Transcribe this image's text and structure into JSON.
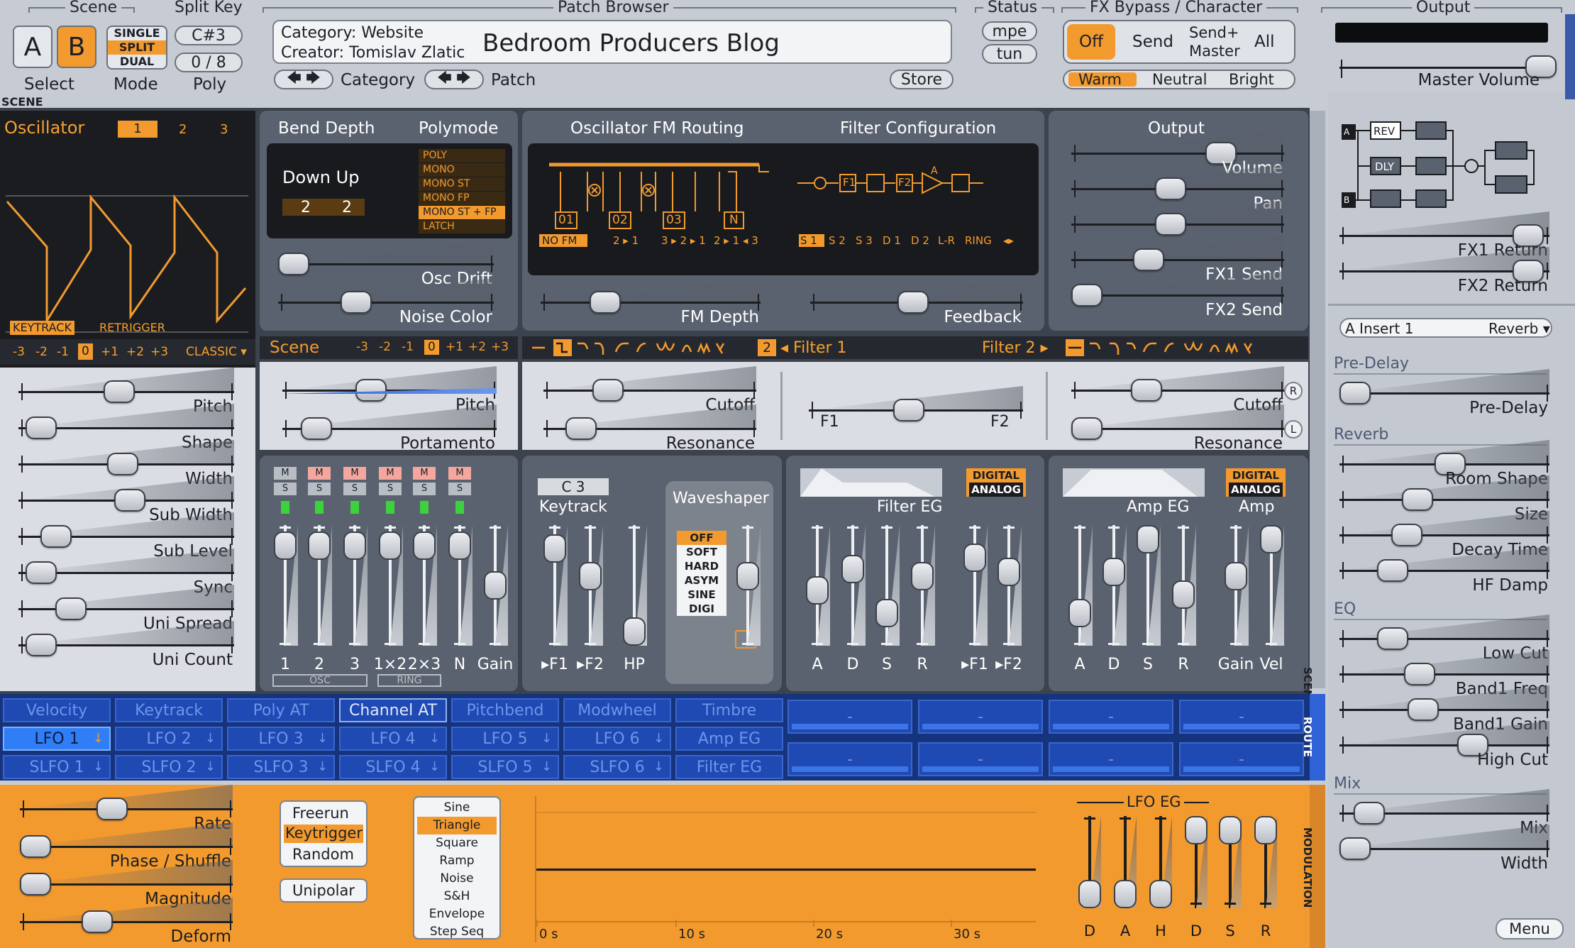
{
  "top": {
    "scene": {
      "title": "Scene",
      "btn_a": "A",
      "btn_b": "B",
      "select_label": "Select",
      "mode_label": "Mode",
      "modes": [
        "SINGLE",
        "SPLIT",
        "DUAL"
      ]
    },
    "split_key": {
      "title": "Split Key",
      "key": "C#3",
      "poly_value": "0 / 8",
      "poly_label": "Poly"
    },
    "patch_browser": {
      "title": "Patch Browser",
      "category_line": "Category: Website",
      "creator_line": "Creator: Tomislav Zlatic",
      "patch_name": "Bedroom Producers Blog",
      "category_label": "Category",
      "patch_label": "Patch",
      "store_label": "Store",
      "prev_glyph": "🡄",
      "next_glyph": "🡆"
    },
    "status": {
      "title": "Status",
      "mpe": "mpe",
      "tun": "tun"
    },
    "fx": {
      "title": "FX Bypass / Character",
      "off": "Off",
      "send": "Send",
      "send_master_1": "Send+",
      "send_master_2": "Master",
      "all": "All",
      "warm": "Warm",
      "neutral": "Neutral",
      "bright": "Bright"
    },
    "output": {
      "title": "Output",
      "master_volume": "Master Volume"
    }
  },
  "scene_tag": "SCENE",
  "osc": {
    "title": "Oscillator",
    "tabs": [
      "1",
      "2",
      "3"
    ],
    "keytrack": "KEYTRACK",
    "retrigger": "RETRIGGER",
    "octaves": [
      "-3",
      "-2",
      "-1",
      "0",
      "+1",
      "+2",
      "+3"
    ],
    "classic": "CLASSIC ▾",
    "sliders": [
      "Pitch",
      "Shape",
      "Width",
      "Sub Width",
      "Sub Level",
      "Sync",
      "Uni Spread",
      "Uni Count"
    ]
  },
  "bend": {
    "title": "Bend Depth",
    "polymode_title": "Polymode",
    "down_up": "Down Up",
    "down": "2",
    "up": "2",
    "polymodes": [
      "POLY",
      "MONO",
      "MONO ST",
      "MONO FP",
      "MONO ST + FP",
      "LATCH"
    ],
    "osc_drift": "Osc Drift",
    "noise_color": "Noise Color"
  },
  "scene_panel": {
    "title": "Scene",
    "octaves": [
      "-3",
      "-2",
      "-1",
      "0",
      "+1",
      "+2",
      "+3"
    ],
    "pitch": "Pitch",
    "portamento": "Portamento"
  },
  "fm": {
    "title": "Oscillator FM Routing",
    "nodes": [
      "01",
      "02",
      "03",
      "N"
    ],
    "modes": [
      "NO FM",
      "2 ▸ 1",
      "3 ▸ 2 ▸ 1",
      "2 ▸ 1 ◂ 3"
    ],
    "fm_depth": "FM Depth"
  },
  "filter_cfg": {
    "title": "Filter Configuration",
    "f1": "F1",
    "f2": "F2",
    "a": "A",
    "modes": [
      "S 1",
      "S 2",
      "S 3",
      "D 1",
      "D 2",
      "L-R",
      "RING",
      "◂▸"
    ],
    "feedback": "Feedback"
  },
  "out_panel": {
    "title": "Output",
    "sliders": [
      "Volume",
      "Pan",
      "",
      "FX1 Send",
      "FX2 Send"
    ]
  },
  "filters": {
    "num": "2",
    "filter1": "◂ Filter 1",
    "filter2": "Filter 2 ▸",
    "cutoff": "Cutoff",
    "resonance": "Resonance",
    "f1": "F1",
    "f2": "F2",
    "r": "R",
    "l": "L"
  },
  "mixer": {
    "labels": [
      "1",
      "2",
      "3",
      "1×2",
      "2×3",
      "N",
      "Gain"
    ],
    "m": "M",
    "s": "S",
    "osc": "OSC",
    "ring": "RING"
  },
  "keytrack_panel": {
    "note": "C 3",
    "title": "Keytrack",
    "labels": [
      "▸F1",
      "▸F2",
      "HP"
    ],
    "waveshaper": "Waveshaper",
    "shapes": [
      "OFF",
      "SOFT",
      "HARD",
      "ASYM",
      "SINE",
      "DIGI"
    ]
  },
  "filter_eg": {
    "title": "Filter EG",
    "digital": "DIGITAL",
    "analog": "ANALOG",
    "labels": [
      "A",
      "D",
      "S",
      "R",
      "▸F1",
      "▸F2"
    ]
  },
  "amp_eg": {
    "title": "Amp EG",
    "amp": "Amp",
    "digital": "DIGITAL",
    "analog": "ANALOG",
    "labels": [
      "A",
      "D",
      "S",
      "R",
      "Gain",
      "Vel"
    ]
  },
  "routing": {
    "row1": [
      "Velocity",
      "Keytrack",
      "Poly AT",
      "Channel AT",
      "Pitchbend",
      "Modwheel",
      "Timbre"
    ],
    "row2": [
      "LFO 1",
      "LFO 2",
      "LFO 3",
      "LFO 4",
      "LFO 5",
      "LFO 6",
      "Amp EG"
    ],
    "row3": [
      "SLFO 1",
      "SLFO 2",
      "SLFO 3",
      "SLFO 4",
      "SLFO 5",
      "SLFO 6",
      "Filter EG"
    ],
    "macro": "-",
    "route_tag": "ROUTE",
    "scene_side": "SCENE"
  },
  "modulation": {
    "sliders": [
      "Rate",
      "Phase / Shuffle",
      "Magnitude",
      "Deform"
    ],
    "triggers": [
      "Freerun",
      "Keytrigger",
      "Random"
    ],
    "unipolar": "Unipolar",
    "shapes": [
      "Sine",
      "Triangle",
      "Square",
      "Ramp",
      "Noise",
      "S&H",
      "Envelope",
      "Step Seq"
    ],
    "time_ticks": [
      "0 s",
      "10 s",
      "20 s",
      "30 s"
    ],
    "lfo_eg": "LFO EG",
    "eg_labels": [
      "D",
      "A",
      "H",
      "D",
      "S",
      "R"
    ],
    "tag": "MODULATION"
  },
  "fx_panel": {
    "returns": [
      "FX1 Return",
      "FX2 Return"
    ],
    "rev": "REV",
    "dly": "DLY",
    "a": "A",
    "b": "B",
    "insert": "A Insert 1",
    "insert_type": "Reverb ▾",
    "pre_delay_hdr": "Pre-Delay",
    "pre_delay": "Pre-Delay",
    "reverb_hdr": "Reverb",
    "reverb": [
      "Room Shape",
      "Size",
      "Decay Time",
      "HF Damp"
    ],
    "eq_hdr": "EQ",
    "eq": [
      "Low Cut",
      "Band1 Freq",
      "Band1 Gain",
      "High Cut"
    ],
    "mix_hdr": "Mix",
    "mix": [
      "Mix",
      "Width"
    ],
    "menu": "Menu"
  },
  "colors": {
    "orange": "#f29a2e",
    "route_blue": "#1f49b3",
    "panel": "#5a6270",
    "dark": "#181a1e"
  }
}
